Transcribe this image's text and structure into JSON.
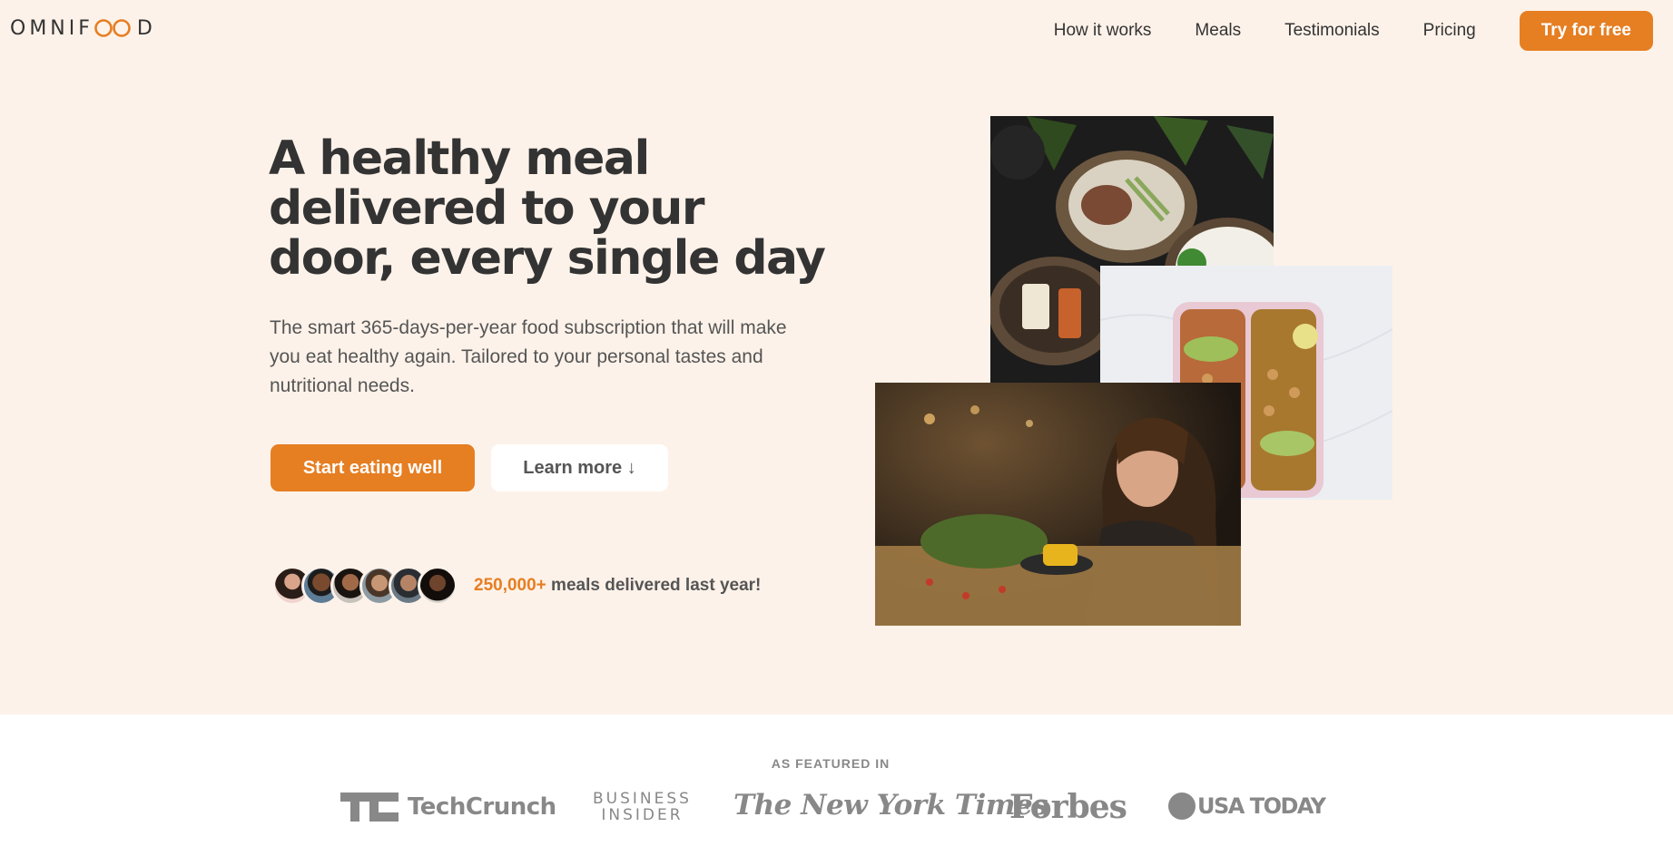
{
  "header": {
    "logo_text_start": "OMNIF",
    "logo_text_end": "D",
    "nav": [
      "How it works",
      "Meals",
      "Testimonials",
      "Pricing"
    ],
    "cta_label": "Try for free"
  },
  "hero": {
    "title": "A healthy meal delivered to your door, every single day",
    "description": "The smart 365-days-per-year food subscription that will make you eat healthy again. Tailored to your personal tastes and nutritional needs.",
    "primary_button": "Start eating well",
    "secondary_button": "Learn more ↓",
    "customers_count": "250,000+",
    "customers_text": " meals delivered last year!"
  },
  "featured": {
    "label": "AS FEATURED IN",
    "logos": {
      "techcrunch": "TechCrunch",
      "business_insider_line1": "BUSINESS",
      "business_insider_line2": "INSIDER",
      "nyt": "The New York Times",
      "forbes": "Forbes",
      "usa_today": "USA TODAY"
    }
  },
  "colors": {
    "primary": "#e67e22",
    "hero_background": "#fdf2e9",
    "text_dark": "#333333",
    "text_medium": "#555555",
    "logo_gray": "#888888"
  }
}
